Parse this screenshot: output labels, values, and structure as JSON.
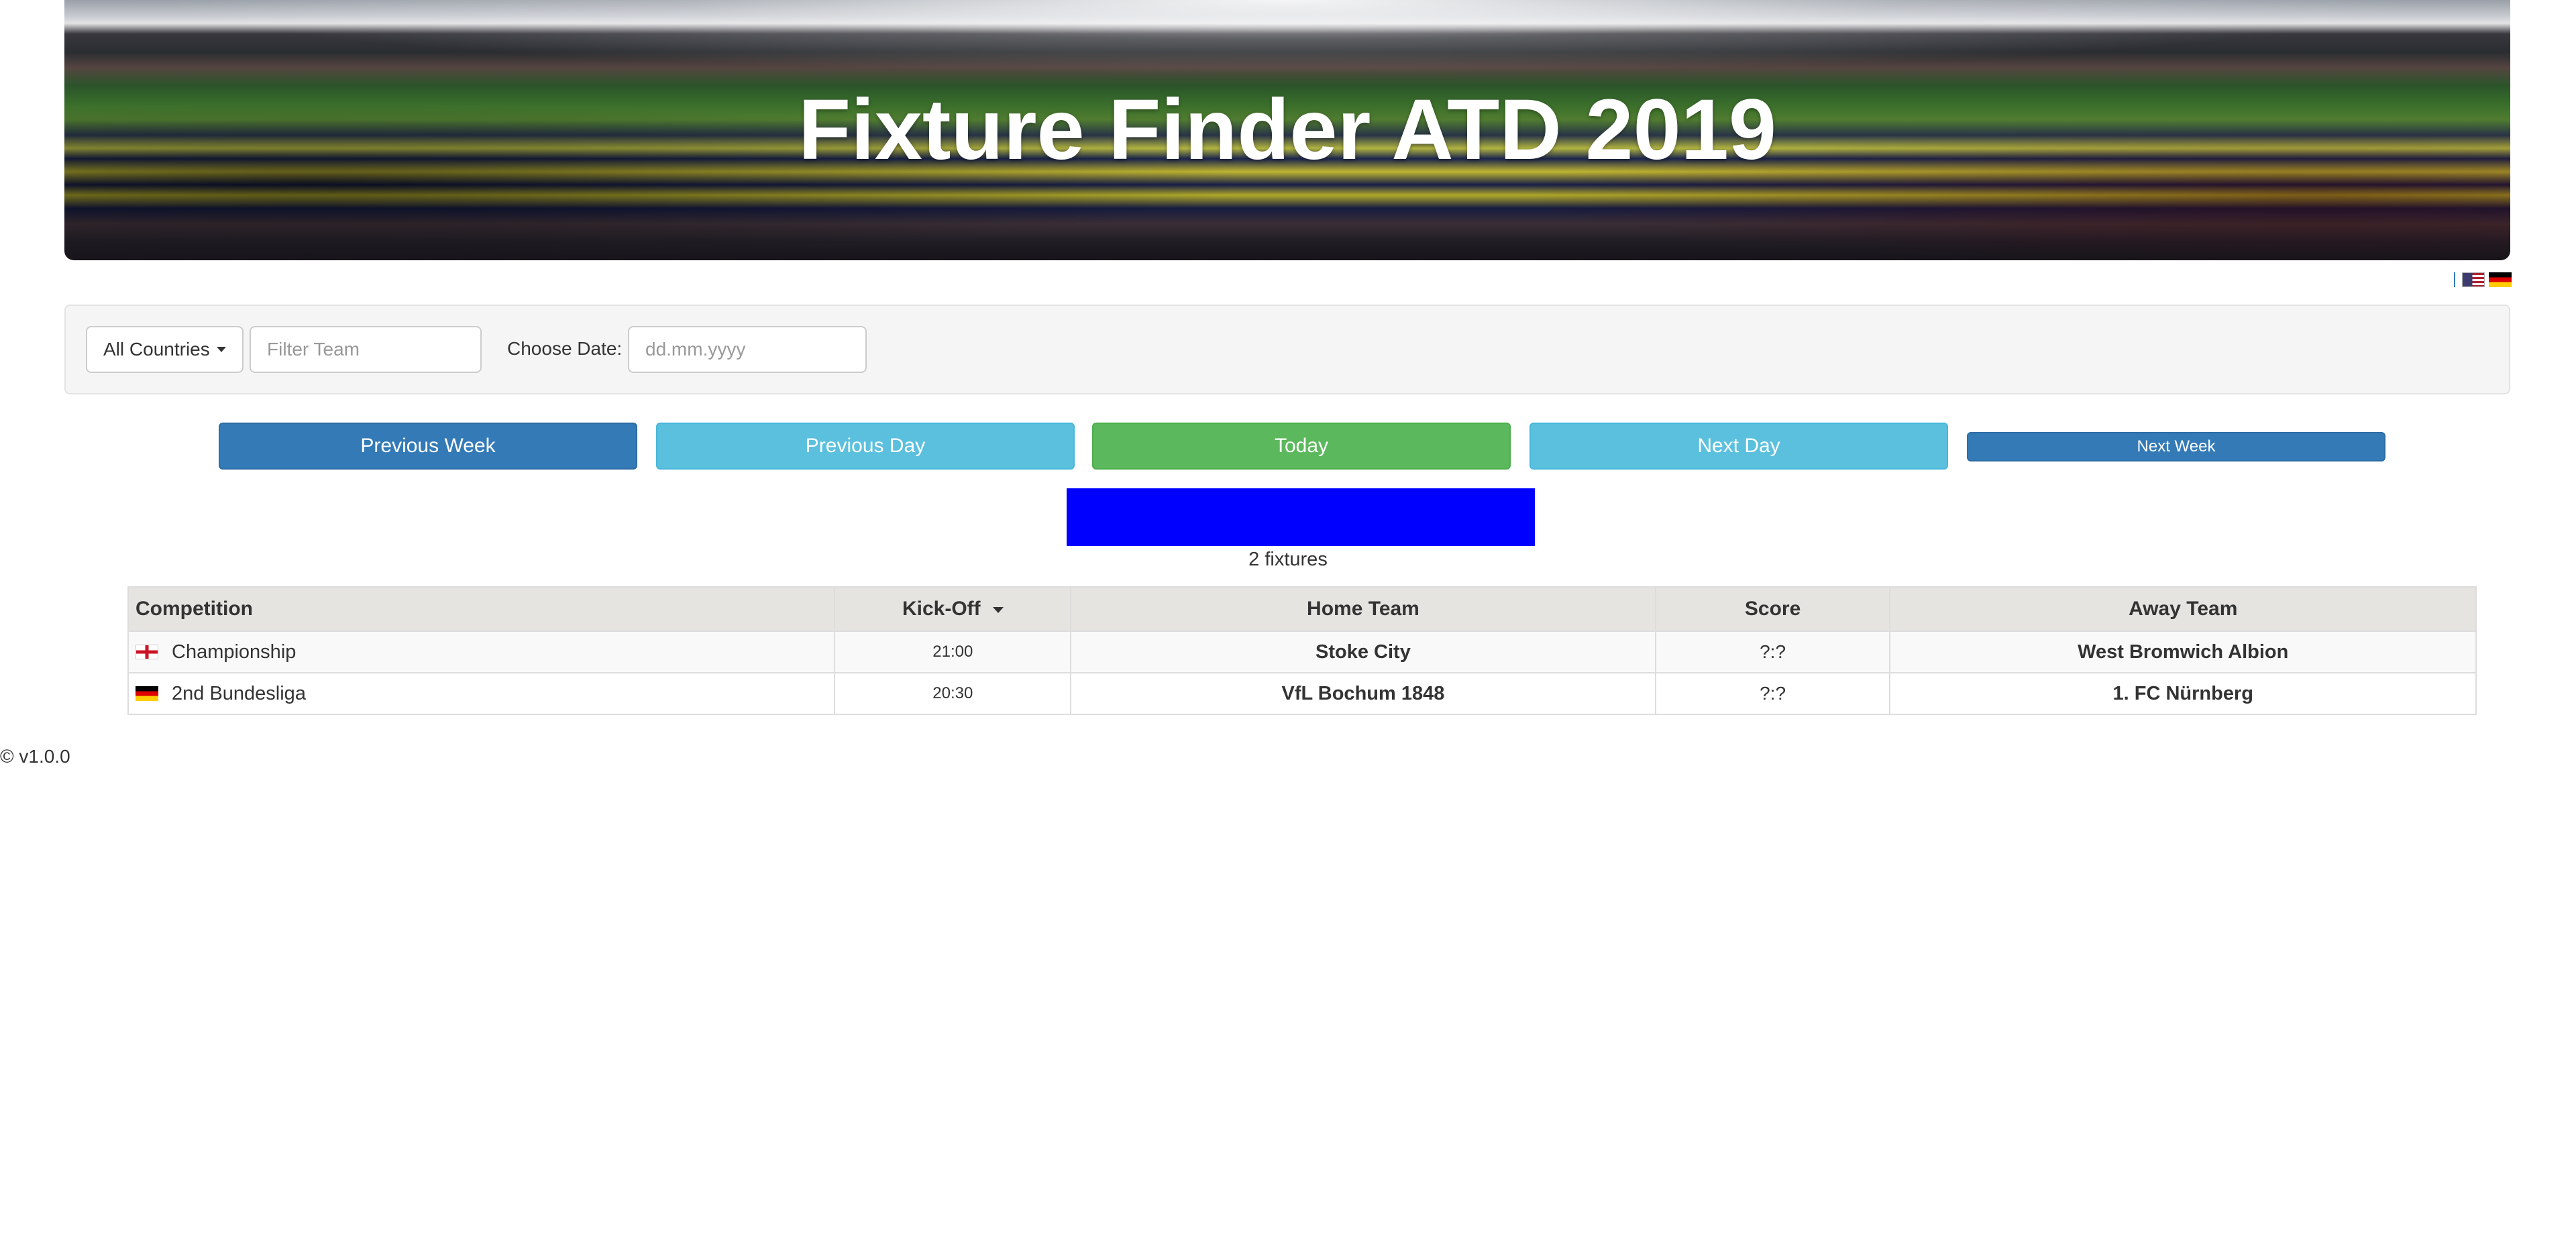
{
  "header": {
    "title": "Fixture Finder ATD 2019"
  },
  "language": {
    "options": [
      {
        "icon": "us-flag-icon"
      },
      {
        "icon": "german-flag-icon"
      }
    ]
  },
  "filters": {
    "country_dropdown_label": "All Countries",
    "team_filter": {
      "value": "",
      "placeholder": "Filter Team"
    },
    "date_label": "Choose Date:",
    "date_input": {
      "value": "",
      "placeholder": "dd.mm.yyyy"
    }
  },
  "navigation": {
    "previous_week": "Previous Week",
    "previous_day": "Previous Day",
    "today": "Today",
    "next_day": "Next Day",
    "next_week": "Next Week"
  },
  "progress": {
    "fill_fraction": 1.0,
    "color": "#0000ff",
    "label": "2 fixtures"
  },
  "table": {
    "columns": {
      "competition": "Competition",
      "kickoff": "Kick-Off",
      "home": "Home Team",
      "score": "Score",
      "away": "Away Team"
    },
    "sort_column": "Kick-Off",
    "rows": [
      {
        "flag_icon": "england-flag-icon",
        "competition": "Championship",
        "kickoff": "21:00",
        "home": "Stoke City",
        "score": "?:?",
        "away": "West Bromwich Albion"
      },
      {
        "flag_icon": "germany-flag-icon",
        "competition": "2nd Bundesliga",
        "kickoff": "20:30",
        "home": "VfL Bochum 1848",
        "score": "?:?",
        "away": "1. FC Nürnberg"
      }
    ]
  },
  "footer": {
    "version": "© v1.0.0"
  },
  "colors": {
    "primary": "#337ab7",
    "info": "#5bc0de",
    "success": "#5cb85c",
    "progress": "#0000ff"
  }
}
